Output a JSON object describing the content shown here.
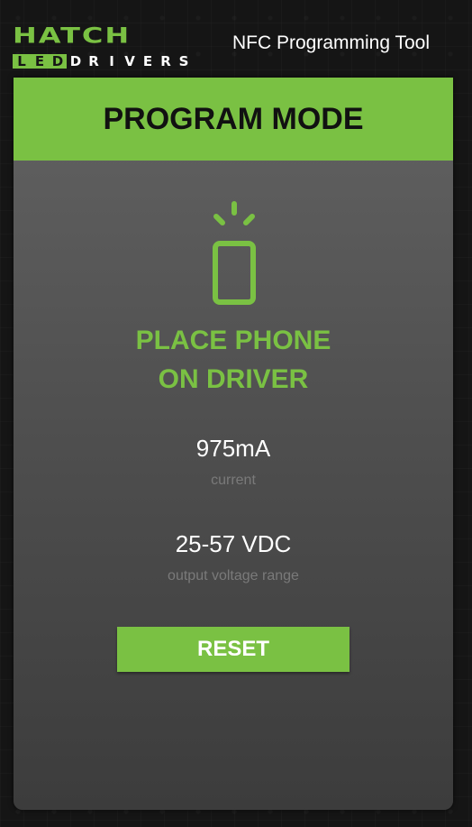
{
  "header": {
    "logo_main": "HATCH",
    "logo_sub_letters": [
      "L",
      "E",
      "D",
      "D",
      "R",
      "I",
      "V",
      "E",
      "R",
      "S"
    ],
    "app_title": "NFC Programming Tool"
  },
  "banner": {
    "title": "PROGRAM MODE"
  },
  "main": {
    "icon": "phone-tap-icon",
    "instruction_line1": "PLACE PHONE",
    "instruction_line2": "ON DRIVER",
    "current_value": "975mA",
    "current_caption": "current",
    "voltage_value": "25-57 VDC",
    "voltage_caption": "output voltage range",
    "reset_label": "RESET"
  },
  "colors": {
    "accent": "#7ac143",
    "card_top": "#626262",
    "card_bottom": "#3c3c3c",
    "background": "#161616"
  }
}
